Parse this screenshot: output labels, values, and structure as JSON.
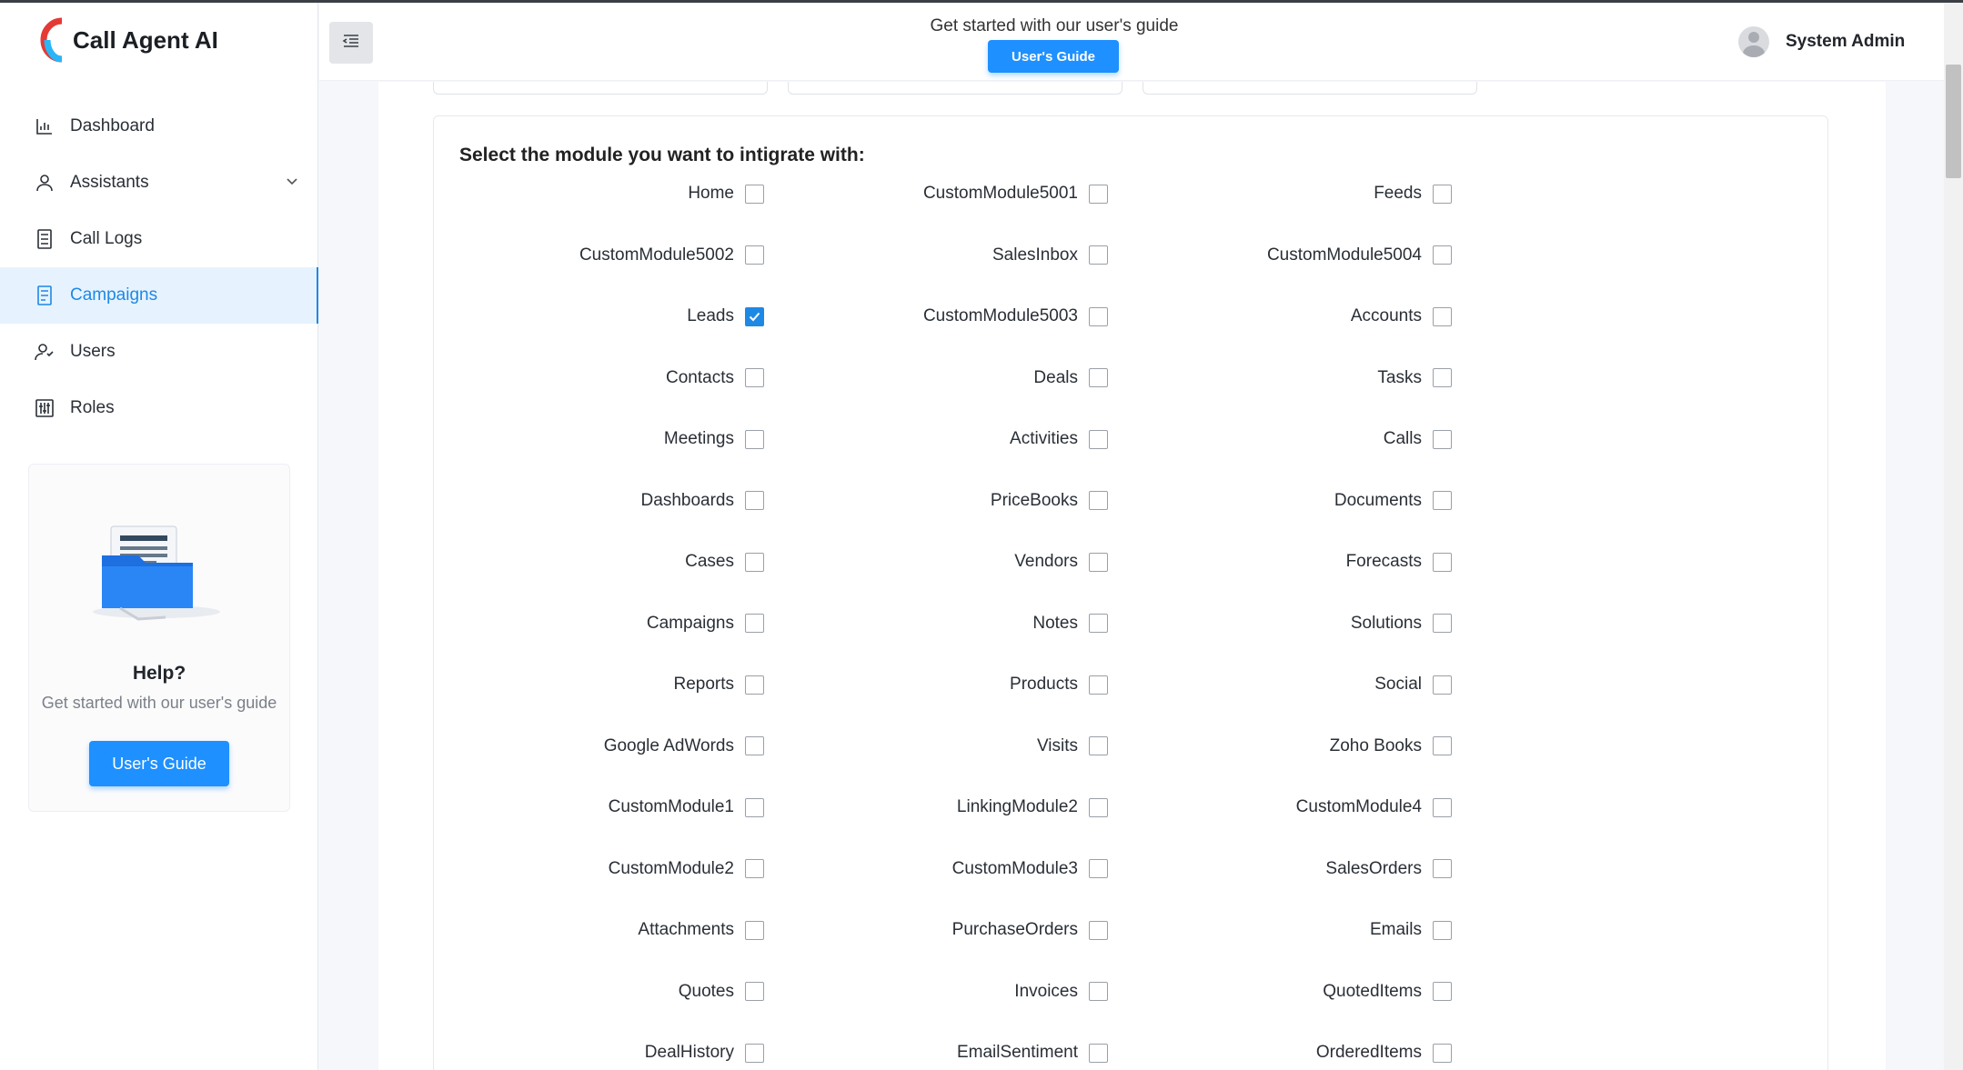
{
  "app": {
    "name": "Call Agent AI"
  },
  "sidebar": {
    "items": [
      {
        "label": "Dashboard",
        "icon": "bar-chart-icon"
      },
      {
        "label": "Assistants",
        "icon": "user-icon",
        "expandable": true
      },
      {
        "label": "Call Logs",
        "icon": "list-doc-icon"
      },
      {
        "label": "Campaigns",
        "icon": "campaign-doc-icon",
        "active": true
      },
      {
        "label": "Users",
        "icon": "users-icon"
      },
      {
        "label": "Roles",
        "icon": "sliders-icon"
      }
    ],
    "help": {
      "title": "Help?",
      "subtitle": "Get started with our user's guide",
      "button": "User's Guide"
    }
  },
  "header": {
    "text": "Get started with our user's guide",
    "button": "User's Guide",
    "user_name": "System Admin"
  },
  "modules": {
    "title": "Select the module you want to intigrate with:",
    "rows": [
      [
        {
          "label": "Home",
          "checked": false
        },
        {
          "label": "CustomModule5001",
          "checked": false
        },
        {
          "label": "Feeds",
          "checked": false
        }
      ],
      [
        {
          "label": "CustomModule5002",
          "checked": false
        },
        {
          "label": "SalesInbox",
          "checked": false
        },
        {
          "label": "CustomModule5004",
          "checked": false
        }
      ],
      [
        {
          "label": "Leads",
          "checked": true
        },
        {
          "label": "CustomModule5003",
          "checked": false
        },
        {
          "label": "Accounts",
          "checked": false
        }
      ],
      [
        {
          "label": "Contacts",
          "checked": false
        },
        {
          "label": "Deals",
          "checked": false
        },
        {
          "label": "Tasks",
          "checked": false
        }
      ],
      [
        {
          "label": "Meetings",
          "checked": false
        },
        {
          "label": "Activities",
          "checked": false
        },
        {
          "label": "Calls",
          "checked": false
        }
      ],
      [
        {
          "label": "Dashboards",
          "checked": false
        },
        {
          "label": "PriceBooks",
          "checked": false
        },
        {
          "label": "Documents",
          "checked": false
        }
      ],
      [
        {
          "label": "Cases",
          "checked": false
        },
        {
          "label": "Vendors",
          "checked": false
        },
        {
          "label": "Forecasts",
          "checked": false
        }
      ],
      [
        {
          "label": "Campaigns",
          "checked": false
        },
        {
          "label": "Notes",
          "checked": false
        },
        {
          "label": "Solutions",
          "checked": false
        }
      ],
      [
        {
          "label": "Reports",
          "checked": false
        },
        {
          "label": "Products",
          "checked": false
        },
        {
          "label": "Social",
          "checked": false
        }
      ],
      [
        {
          "label": "Google AdWords",
          "checked": false
        },
        {
          "label": "Visits",
          "checked": false
        },
        {
          "label": "Zoho Books",
          "checked": false
        }
      ],
      [
        {
          "label": "CustomModule1",
          "checked": false
        },
        {
          "label": "LinkingModule2",
          "checked": false
        },
        {
          "label": "CustomModule4",
          "checked": false
        }
      ],
      [
        {
          "label": "CustomModule2",
          "checked": false
        },
        {
          "label": "CustomModule3",
          "checked": false
        },
        {
          "label": "SalesOrders",
          "checked": false
        }
      ],
      [
        {
          "label": "Attachments",
          "checked": false
        },
        {
          "label": "PurchaseOrders",
          "checked": false
        },
        {
          "label": "Emails",
          "checked": false
        }
      ],
      [
        {
          "label": "Quotes",
          "checked": false
        },
        {
          "label": "Invoices",
          "checked": false
        },
        {
          "label": "QuotedItems",
          "checked": false
        }
      ],
      [
        {
          "label": "DealHistory",
          "checked": false
        },
        {
          "label": "EmailSentiment",
          "checked": false
        },
        {
          "label": "OrderedItems",
          "checked": false
        }
      ]
    ]
  },
  "colors": {
    "accent": "#1e88e5",
    "button": "#1e90ff",
    "active_bg": "#e6f3ff"
  }
}
